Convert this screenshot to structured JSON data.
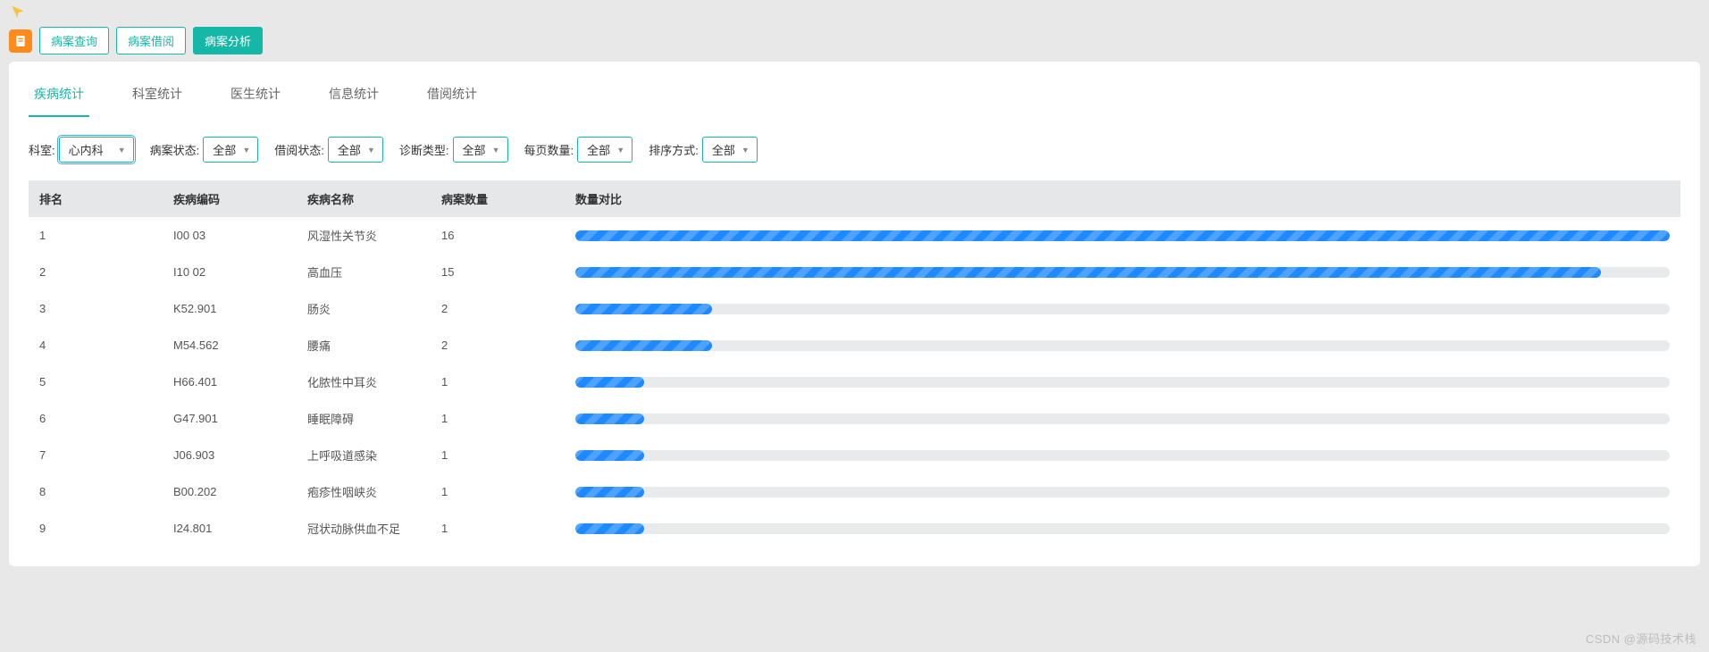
{
  "top_icons": {
    "pointer": "pointer-icon",
    "square": "app-square-icon"
  },
  "toolbar_buttons": [
    {
      "label": "病案查询",
      "active": false,
      "name": "toolbar-query"
    },
    {
      "label": "病案借阅",
      "active": false,
      "name": "toolbar-borrow"
    },
    {
      "label": "病案分析",
      "active": true,
      "name": "toolbar-analysis"
    }
  ],
  "tabs": [
    {
      "label": "疾病统计",
      "active": true,
      "name": "tab-disease"
    },
    {
      "label": "科室统计",
      "active": false,
      "name": "tab-department"
    },
    {
      "label": "医生统计",
      "active": false,
      "name": "tab-doctor"
    },
    {
      "label": "信息统计",
      "active": false,
      "name": "tab-info"
    },
    {
      "label": "借阅统计",
      "active": false,
      "name": "tab-borrow"
    }
  ],
  "filters": {
    "dept": {
      "label": "科室:",
      "value": "心内科",
      "name": "filter-dept"
    },
    "case_status": {
      "label": "病案状态:",
      "value": "全部",
      "name": "filter-case-status"
    },
    "loan_status": {
      "label": "借阅状态:",
      "value": "全部",
      "name": "filter-loan-status"
    },
    "diag_type": {
      "label": "诊断类型:",
      "value": "全部",
      "name": "filter-diag-type"
    },
    "page_size": {
      "label": "每页数量:",
      "value": "全部",
      "name": "filter-page-size"
    },
    "sort": {
      "label": "排序方式:",
      "value": "全部",
      "name": "filter-sort"
    }
  },
  "table": {
    "headers": {
      "rank": "排名",
      "code": "疾病编码",
      "name": "疾病名称",
      "count": "病案数量",
      "compare": "数量对比"
    },
    "rows": [
      {
        "rank": "1",
        "code": "I00 03",
        "name": "风湿性关节炎",
        "count": "16"
      },
      {
        "rank": "2",
        "code": "I10 02",
        "name": "高血压",
        "count": "15"
      },
      {
        "rank": "3",
        "code": "K52.901",
        "name": "肠炎",
        "count": "2"
      },
      {
        "rank": "4",
        "code": "M54.562",
        "name": "腰痛",
        "count": "2"
      },
      {
        "rank": "5",
        "code": "H66.401",
        "name": "化脓性中耳炎",
        "count": "1"
      },
      {
        "rank": "6",
        "code": "G47.901",
        "name": "睡眠障碍",
        "count": "1"
      },
      {
        "rank": "7",
        "code": "J06.903",
        "name": "上呼吸道感染",
        "count": "1"
      },
      {
        "rank": "8",
        "code": "B00.202",
        "name": "疱疹性咽峡炎",
        "count": "1"
      },
      {
        "rank": "9",
        "code": "I24.801",
        "name": "冠状动脉供血不足",
        "count": "1"
      }
    ]
  },
  "chart_data": {
    "type": "bar",
    "title": "",
    "xlabel": "",
    "ylabel": "病案数量",
    "ylim": [
      0,
      16
    ],
    "categories": [
      "风湿性关节炎",
      "高血压",
      "肠炎",
      "腰痛",
      "化脓性中耳炎",
      "睡眠障碍",
      "上呼吸道感染",
      "疱疹性咽峡炎",
      "冠状动脉供血不足"
    ],
    "values": [
      16,
      15,
      2,
      2,
      1,
      1,
      1,
      1,
      1
    ]
  },
  "watermark": "CSDN @源码技术栈"
}
